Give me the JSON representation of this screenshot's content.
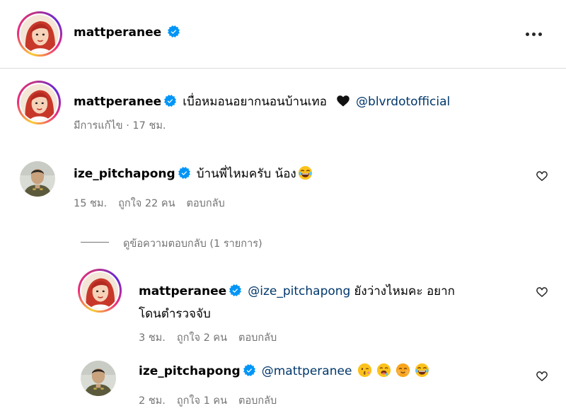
{
  "post": {
    "author": "mattperanee",
    "caption": {
      "username": "mattperanee",
      "text": "เบื่อหมอนอยากนอนบ้านเทอ",
      "mention": "@blvrdotofficial",
      "meta": "มีการแก้ไข · 17 ชม."
    }
  },
  "comments": [
    {
      "username": "ize_pitchapong",
      "text": "บ้านพี่ไหมครับ น้อง",
      "emoji": [
        "laughing-tears-emoji"
      ],
      "time": "15 ชม.",
      "likes": "ถูกใจ 22 คน",
      "reply_label": "ตอบกลับ",
      "view_replies": "ดูข้อความตอบกลับ (1 รายการ)"
    }
  ],
  "replies": [
    {
      "username": "mattperanee",
      "mention": "@ize_pitchapong",
      "text_line1": "ยังว่างไหมคะ อยาก",
      "text_line2": "โดนตำรวจจับ",
      "time": "3 ชม.",
      "likes": "ถูกใจ 2 คน",
      "reply_label": "ตอบกลับ"
    },
    {
      "username": "ize_pitchapong",
      "mention": "@mattperanee",
      "emoji": [
        "kissing-emoji",
        "drooling-emoji",
        "blushing-emoji",
        "laughing-tears-emoji"
      ],
      "time": "2 ชม.",
      "likes": "ถูกใจ 1 คน",
      "reply_label": "ตอบกลับ"
    }
  ],
  "colors": {
    "verified": "#0095f6",
    "mention": "#00376b",
    "meta": "#737373"
  }
}
